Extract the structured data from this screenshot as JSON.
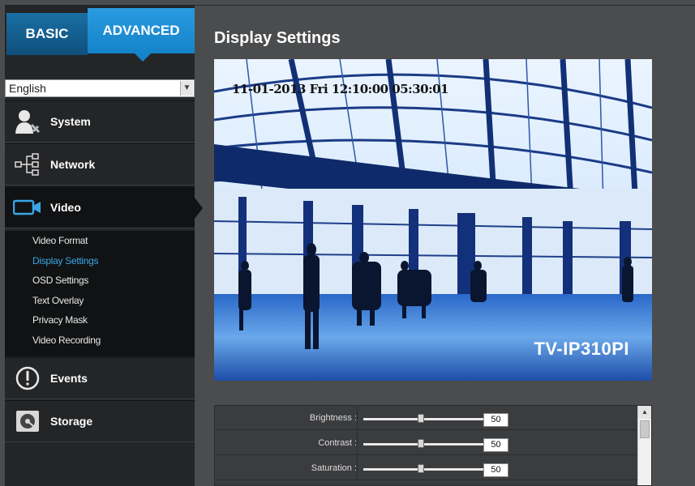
{
  "mode_tabs": {
    "basic": "BASIC",
    "advanced": "ADVANCED"
  },
  "language": {
    "selected": "English"
  },
  "nav": {
    "system": "System",
    "network": "Network",
    "video": "Video",
    "events": "Events",
    "storage": "Storage"
  },
  "video_submenu": [
    "Video Format",
    "Display Settings",
    "OSD Settings",
    "Text Overlay",
    "Privacy Mask",
    "Video Recording"
  ],
  "page": {
    "title": "Display Settings"
  },
  "preview": {
    "osd_timestamp": "11-01-2013 Fri 12:10:00 05:30:01",
    "model_overlay": "TV-IP310PI"
  },
  "display_settings": [
    {
      "label": "Brightness :",
      "value": "50"
    },
    {
      "label": "Contrast :",
      "value": "50"
    },
    {
      "label": "Saturation :",
      "value": "50"
    }
  ],
  "colors": {
    "accent": "#1583c9",
    "active_submenu": "#3aa6e8",
    "sidebar": "#242527",
    "background": "#4b4c4e"
  }
}
